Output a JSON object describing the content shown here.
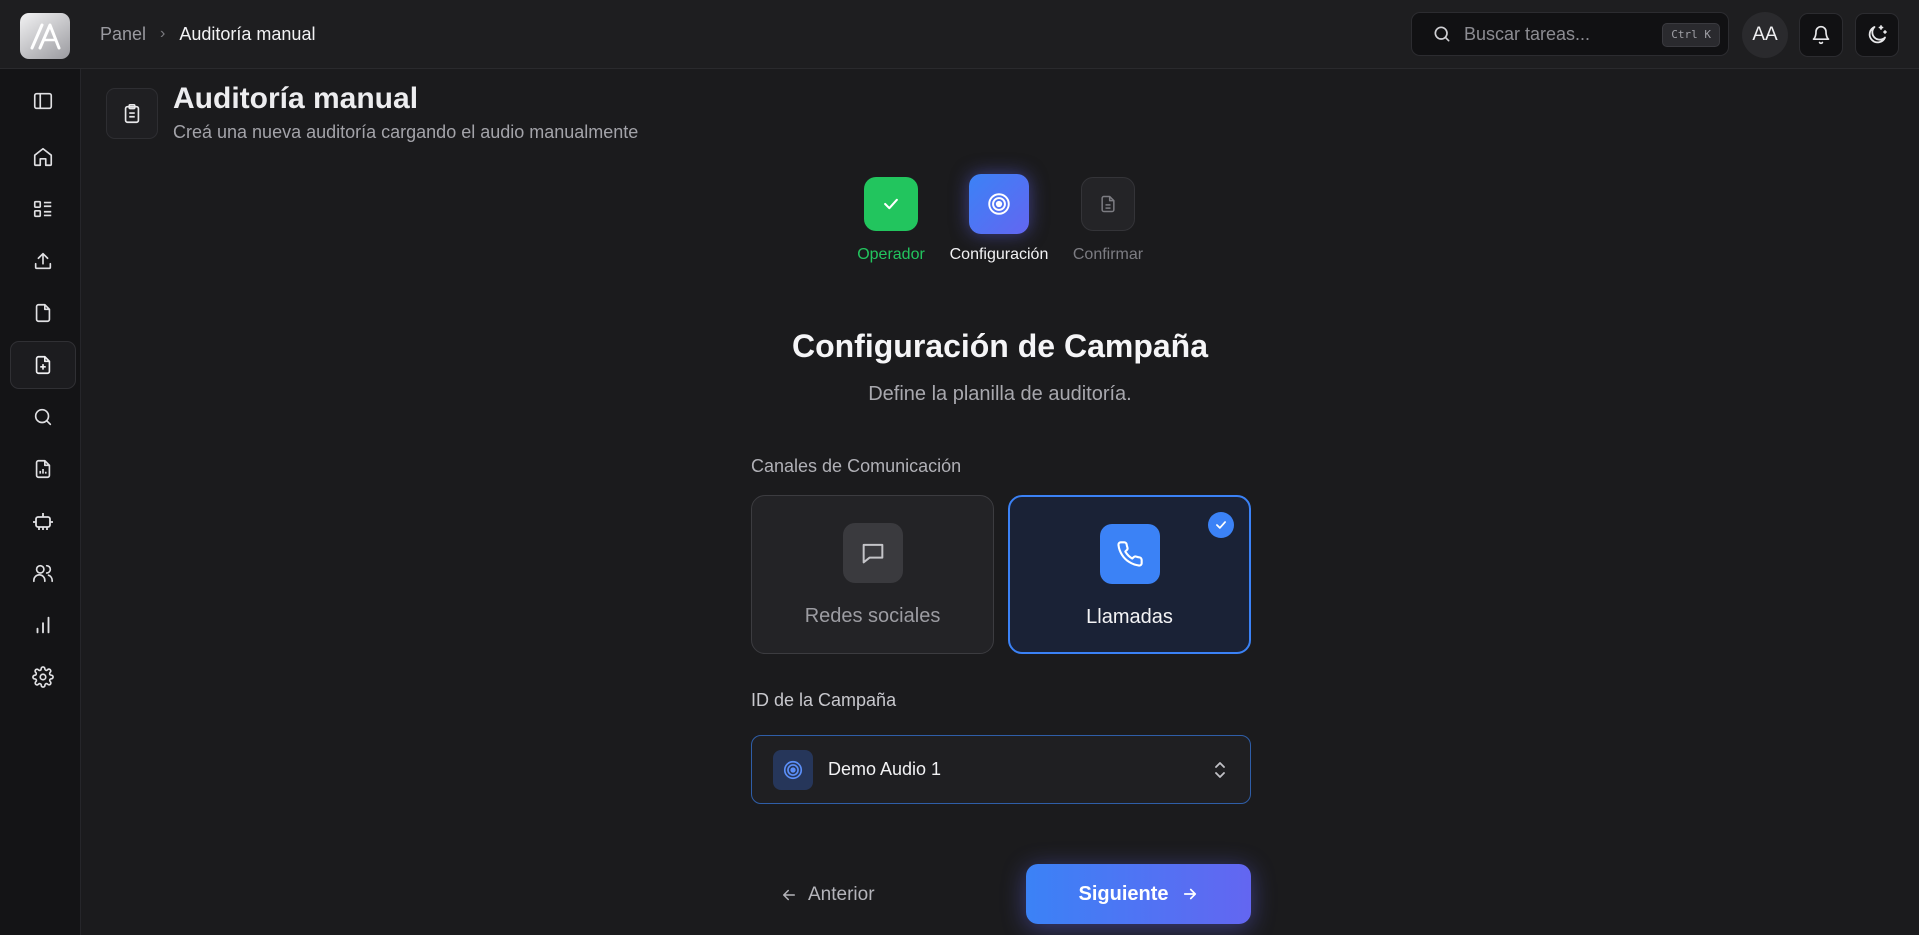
{
  "app": {
    "logo_icon": "app-logo-icon"
  },
  "breadcrumb": {
    "parent": "Panel",
    "separator": "›",
    "current": "Auditoría manual"
  },
  "search": {
    "placeholder": "Buscar tareas...",
    "shortcut": "Ctrl K"
  },
  "user": {
    "initials": "AA"
  },
  "sidebar": {
    "items": [
      {
        "name": "sidebar-toggle",
        "icon": "sidebar-toggle-icon"
      },
      {
        "name": "home",
        "icon": "home-icon"
      },
      {
        "name": "dashboard",
        "icon": "list-grid-icon"
      },
      {
        "name": "upload",
        "icon": "upload-icon"
      },
      {
        "name": "documents",
        "icon": "file-icon"
      },
      {
        "name": "new-audit",
        "icon": "file-plus-icon",
        "active": true
      },
      {
        "name": "search",
        "icon": "search-icon"
      },
      {
        "name": "reports",
        "icon": "file-chart-icon"
      },
      {
        "name": "robot",
        "icon": "bot-icon"
      },
      {
        "name": "users",
        "icon": "users-icon"
      },
      {
        "name": "analytics",
        "icon": "bar-chart-icon"
      },
      {
        "name": "settings",
        "icon": "gear-icon"
      }
    ]
  },
  "page": {
    "title": "Auditoría manual",
    "subtitle": "Creá una nueva auditoría cargando el audio manualmente"
  },
  "stepper": {
    "steps": [
      {
        "label": "Operador",
        "status": "done"
      },
      {
        "label": "Configuración",
        "status": "current"
      },
      {
        "label": "Confirmar",
        "status": "pending"
      }
    ]
  },
  "form": {
    "title": "Configuración de Campaña",
    "subtitle": "Define la planilla de auditoría.",
    "channels_label": "Canales de Comunicación",
    "channels": [
      {
        "label": "Redes sociales",
        "icon": "chat-bubble-icon",
        "selected": false
      },
      {
        "label": "Llamadas",
        "icon": "phone-icon",
        "selected": true
      }
    ],
    "campaign_label": "ID de la Campaña",
    "campaign_value": "Demo Audio 1"
  },
  "nav": {
    "back": "Anterior",
    "next": "Siguiente"
  },
  "colors": {
    "accent": "#3b82f6",
    "accent2": "#6366f1",
    "success": "#22c55e",
    "background": "#1b1b1d"
  }
}
